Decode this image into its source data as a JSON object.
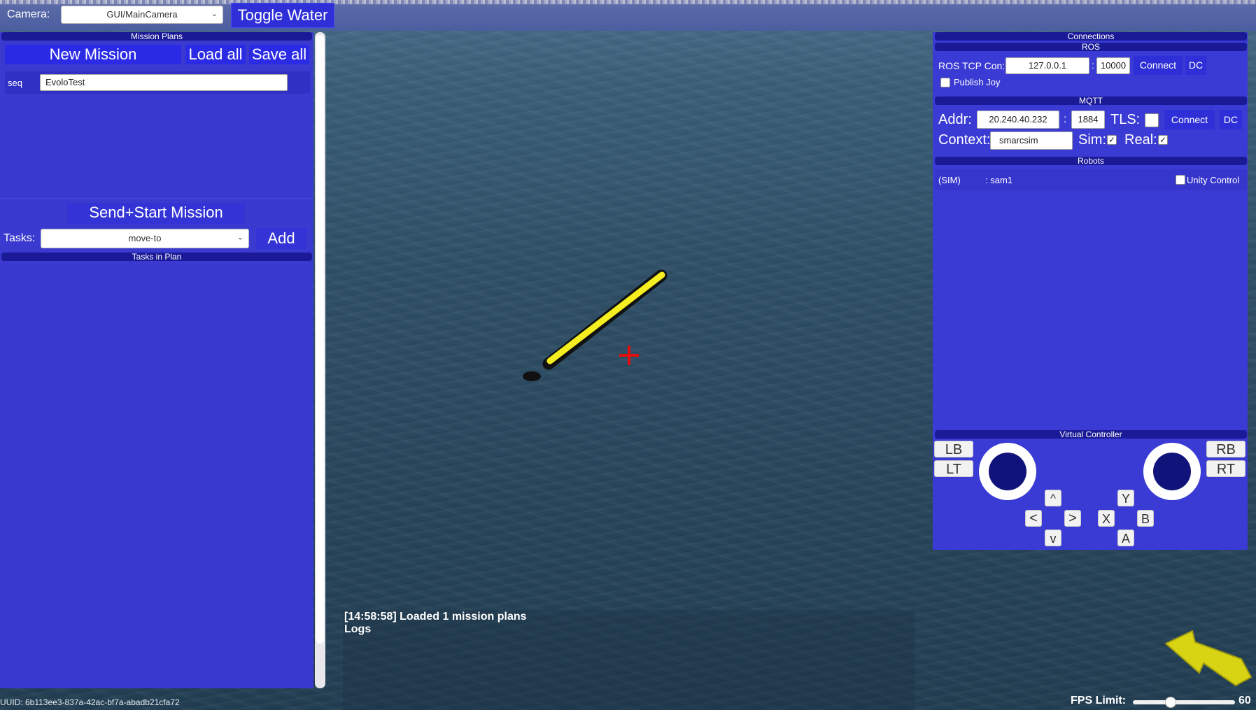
{
  "topbar": {
    "camera_label": "Camera:",
    "camera_value": "GUI/MainCamera",
    "toggle_water": "Toggle Water"
  },
  "mission_panel": {
    "header": "Mission Plans",
    "new_mission": "New Mission",
    "load_all": "Load all",
    "save_all": "Save all",
    "plan_type": "seq",
    "plan_name": "EvoloTest",
    "send_start": "Send+Start Mission",
    "tasks_label": "Tasks:",
    "task_selected": "move-to",
    "add": "Add",
    "tasks_header": "Tasks in Plan"
  },
  "connections": {
    "header": "Connections",
    "ros": {
      "header": "ROS",
      "tcp_label": "ROS TCP Con:",
      "ip": "127.0.0.1",
      "port_sep": ":",
      "port": "10000",
      "connect": "Connect",
      "dc": "DC",
      "publish_joy": "Publish Joy",
      "publish_joy_checked": false
    },
    "mqtt": {
      "header": "MQTT",
      "addr_label": "Addr:",
      "addr": "20.240.40.232",
      "port_sep": ":",
      "port": "1884",
      "tls_label": "TLS:",
      "tls_checked": false,
      "connect": "Connect",
      "dc": "DC",
      "context_label": "Context:",
      "context": "smarcsim",
      "sim_label": "Sim:",
      "sim_checked": true,
      "real_label": "Real:",
      "real_checked": true
    },
    "robots": {
      "header": "Robots",
      "items": [
        {
          "kind": "(SIM)",
          "name": ": sam1",
          "unity_control": "Unity Control",
          "unity_checked": false
        }
      ]
    }
  },
  "controller": {
    "header": "Virtual Controller",
    "lb": "LB",
    "lt": "LT",
    "rb": "RB",
    "rt": "RT",
    "up": "^",
    "left": "<",
    "right": ">",
    "down": "v",
    "y": "Y",
    "x": "X",
    "b": "B",
    "a": "A"
  },
  "logs": {
    "line": "[14:58:58] Loaded 1 mission plans",
    "title": "Logs"
  },
  "footer": {
    "uuid": "UUID: 6b113ee3-837a-42ac-bf7a-abadb21cfa72",
    "fps_label": "FPS Limit:",
    "fps_value": "60",
    "fps_fraction": 0.37
  },
  "colors": {
    "panel": "#3a3ad0",
    "header": "#1a1a96",
    "button": "#2f2fd8",
    "vehicle": "#f5ee20",
    "crosshair": "#e01010",
    "arrow": "#d8d414"
  },
  "icons": [
    "chevron-down-icon",
    "check-icon",
    "crosshair-icon",
    "direction-arrow-icon",
    "vehicle-icon"
  ]
}
